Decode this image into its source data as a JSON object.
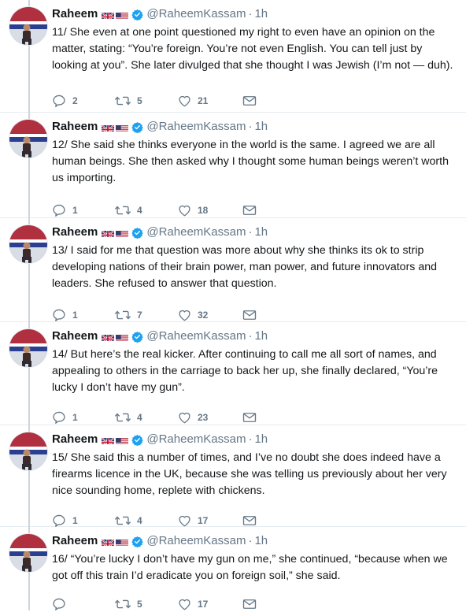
{
  "author": {
    "name": "Raheem",
    "handle": "@RaheemKassam",
    "time": "1h"
  },
  "tweets": [
    {
      "text": "11/ She even at one point questioned my right to even have an opinion on the matter, stating: “You’re foreign. You’re not even English. You can tell just by looking at you”. She later divulged that she thought I was Jewish (I’m not — duh).",
      "replies": "2",
      "retweets": "5",
      "likes": "21"
    },
    {
      "text": "12/ She said she thinks everyone in the world is the same. I agreed we are all human beings. She then asked why I thought some human beings weren’t worth us importing.",
      "replies": "1",
      "retweets": "4",
      "likes": "18"
    },
    {
      "text": "13/ I said for me that question was more about why she thinks its ok to strip developing nations of their brain power, man power, and future innovators and leaders. She refused to answer that question.",
      "replies": "1",
      "retweets": "7",
      "likes": "32"
    },
    {
      "text": "14/ But here’s the real kicker. After continuing to call me all sort of names, and appealing to others in the carriage to back her up, she finally declared, “You’re lucky I don’t have my gun”.",
      "replies": "1",
      "retweets": "4",
      "likes": "23"
    },
    {
      "text": "15/ She said this a number of times, and I’ve no doubt she does indeed have a firearms licence in the UK, because she was telling us previously about her very nice sounding home, replete with chickens.",
      "replies": "1",
      "retweets": "4",
      "likes": "17"
    },
    {
      "text": "16/ “You’re lucky I don’t have my gun on me,” she continued, “because when we got off this train I’d eradicate you on foreign soil,” she said.",
      "replies": "",
      "retweets": "5",
      "likes": "17"
    }
  ],
  "colors": {
    "text": "#14171a",
    "muted": "#657786",
    "verified": "#1da1f2",
    "thread": "#ccd6dd"
  },
  "icons": [
    "reply-icon",
    "retweet-icon",
    "like-icon",
    "direct-message-icon",
    "verified-icon",
    "uk-flag-icon",
    "us-flag-icon"
  ]
}
